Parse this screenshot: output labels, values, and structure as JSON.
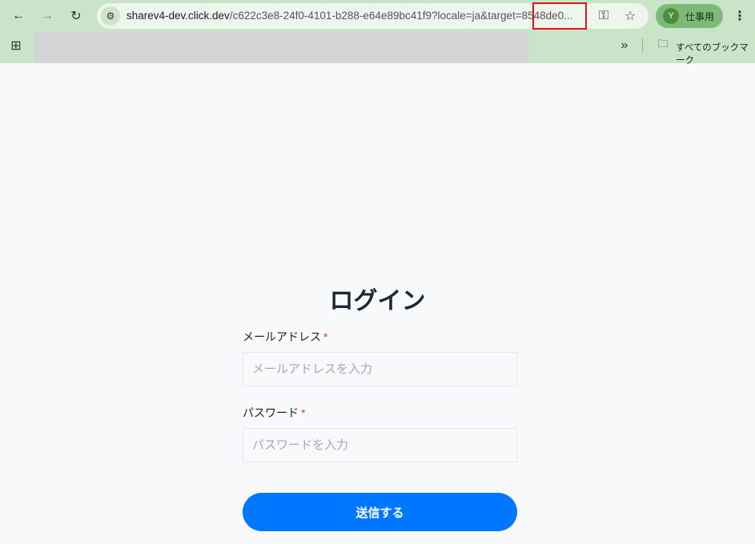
{
  "browser": {
    "url_host": "sharev4-dev.click.dev",
    "url_rest": "/c622c3e8-24f0-4101-b288-e64e89bc41f9?locale=ja&target=8548de0...",
    "profile_initial": "Y",
    "profile_name": "仕事用",
    "all_bookmarks": "すべてのブックマーク"
  },
  "form": {
    "title": "ログイン",
    "email_label": "メールアドレス",
    "email_placeholder": "メールアドレスを入力",
    "password_label": "パスワード",
    "password_placeholder": "パスワードを入力",
    "required_mark": "*",
    "submit_label": "送信する"
  },
  "colors": {
    "accent": "#0077ff",
    "required": "#e53935"
  }
}
